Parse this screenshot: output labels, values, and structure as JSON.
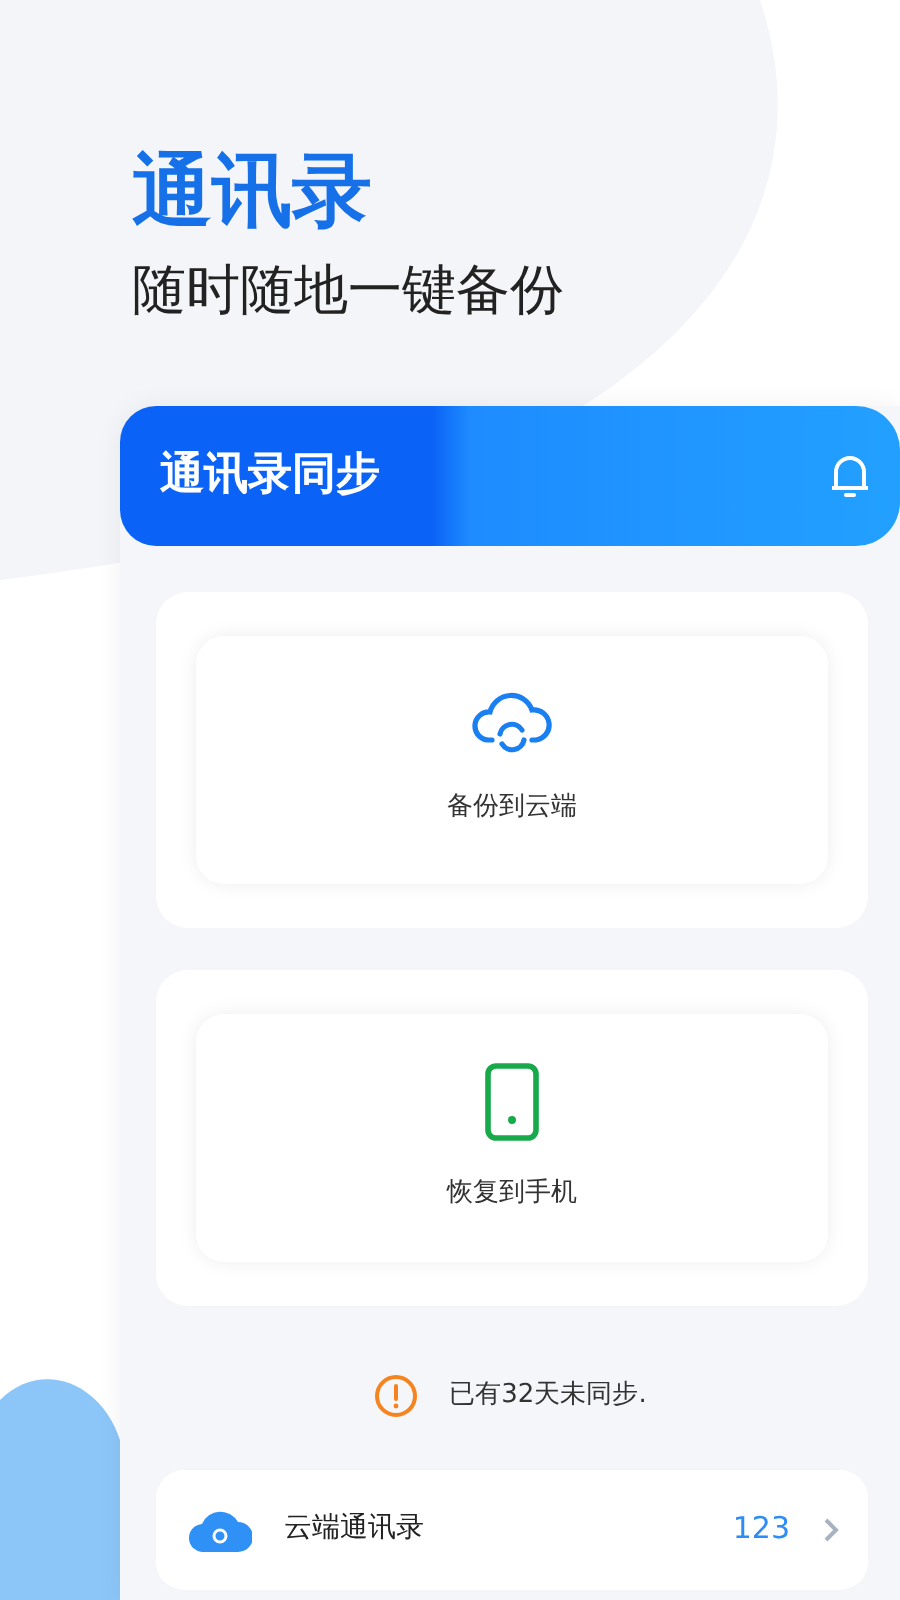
{
  "hero": {
    "title": "通讯录",
    "subtitle": "随时随地一键备份"
  },
  "app": {
    "header": {
      "title": "通讯录同步"
    },
    "actions": [
      {
        "kind": "cloud",
        "label": "备份到云端"
      },
      {
        "kind": "phone",
        "label": "恢复到手机"
      }
    ],
    "notice": {
      "text": "已有32天未同步."
    },
    "rows": [
      {
        "kind": "cloud",
        "label": "云端通讯录",
        "count": "123"
      }
    ]
  }
}
